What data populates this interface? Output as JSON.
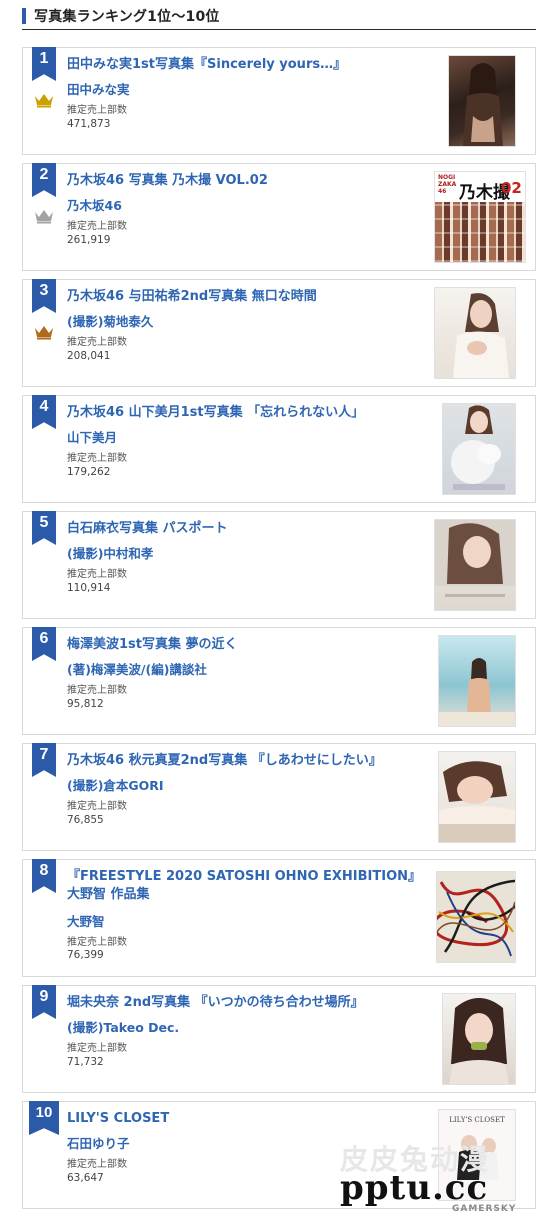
{
  "header": {
    "title": "写真集ランキング1位～10位"
  },
  "sales_label": "推定売上部数",
  "items": [
    {
      "rank": "1",
      "title": "田中みな実1st写真集『Sincerely yours…』",
      "author": "田中みな実",
      "sales": "471,873",
      "crown": "gold"
    },
    {
      "rank": "2",
      "title": "乃木坂46 写真集 乃木撮 VOL.02",
      "author": "乃木坂46",
      "sales": "261,919",
      "crown": "silver"
    },
    {
      "rank": "3",
      "title": "乃木坂46 与田祐希2nd写真集 無口な時間",
      "author": "(撮影)菊地泰久",
      "sales": "208,041",
      "crown": "bronze"
    },
    {
      "rank": "4",
      "title": "乃木坂46 山下美月1st写真集 「忘れられない人」",
      "author": "山下美月",
      "sales": "179,262"
    },
    {
      "rank": "5",
      "title": "白石麻衣写真集 パスポート",
      "author": "(撮影)中村和孝",
      "sales": "110,914"
    },
    {
      "rank": "6",
      "title": "梅澤美波1st写真集 夢の近く",
      "author": "(著)梅澤美波/(編)講談社",
      "sales": "95,812"
    },
    {
      "rank": "7",
      "title": "乃木坂46 秋元真夏2nd写真集 『しあわせにしたい』",
      "author": "(撮影)倉本GORI",
      "sales": "76,855"
    },
    {
      "rank": "8",
      "title": "『FREESTYLE 2020 SATOSHI OHNO EXHIBITION』",
      "title2": "大野智 作品集",
      "author": "大野智",
      "sales": "76,399"
    },
    {
      "rank": "9",
      "title": "堀未央奈 2nd写真集 『いつかの待ち合わせ場所』",
      "author": "(撮影)Takeo Dec.",
      "sales": "71,732"
    },
    {
      "rank": "10",
      "title": "LILY'S CLOSET",
      "author": "石田ゆり子",
      "sales": "63,647"
    }
  ],
  "cover_text": {
    "c2_top": "NOGI ZAKA 46",
    "c2_main": "乃木撮",
    "c2_num": "02",
    "c10_title": "LILY'S CLOSET"
  },
  "watermark": {
    "cjk": "皮皮兔动漫",
    "site": "pptu.cc",
    "brand": "GAMERSKY"
  },
  "colors": {
    "accent": "#2a5aa8",
    "link": "#2f66b3",
    "gold": "#c9a100",
    "silver": "#a3a3a3",
    "bronze": "#b06a1e"
  }
}
